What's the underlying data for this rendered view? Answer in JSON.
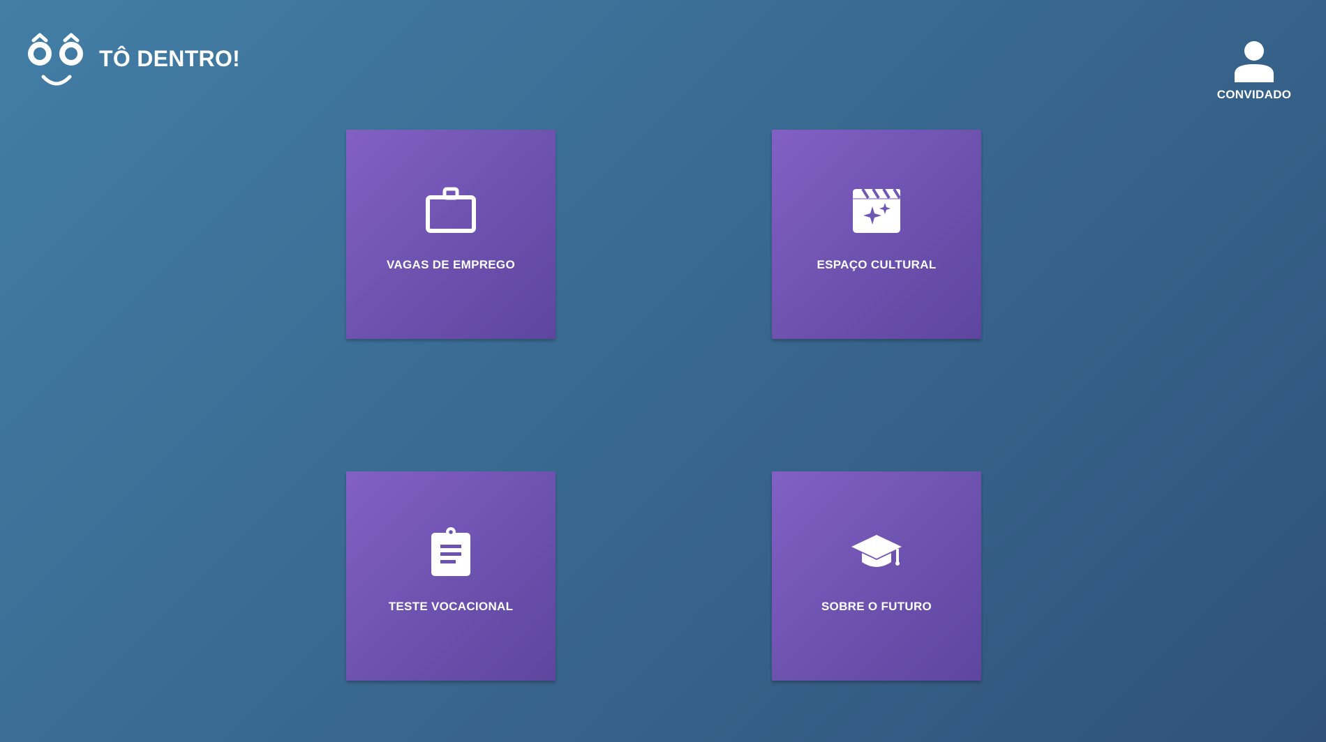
{
  "header": {
    "brand_name": "TÔ DENTRO!",
    "logo_icon": "smiling-face-logo"
  },
  "user": {
    "label": "CONVIDADO",
    "icon": "person-icon"
  },
  "tiles": [
    {
      "label": "VAGAS DE EMPREGO",
      "icon": "briefcase-icon"
    },
    {
      "label": "ESPAÇO CULTURAL",
      "icon": "clapperboard-sparkle-icon"
    },
    {
      "label": "TESTE VOCACIONAL",
      "icon": "clipboard-icon"
    },
    {
      "label": "SOBRE O FUTURO",
      "icon": "graduation-cap-icon"
    }
  ],
  "colors": {
    "background_start": "#427ea6",
    "background_end": "#30527a",
    "tile_start": "#8260c4",
    "tile_end": "#5e469f",
    "foreground": "#ffffff"
  }
}
